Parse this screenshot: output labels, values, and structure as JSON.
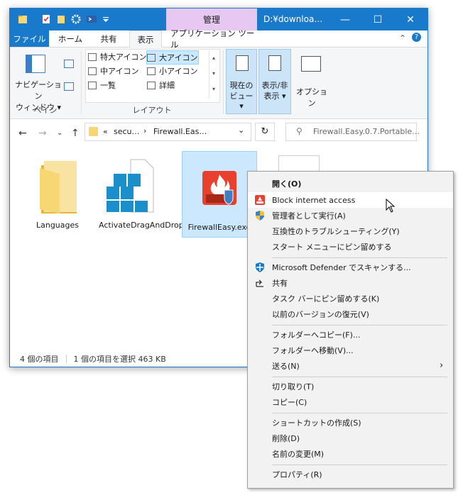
{
  "titlebar": {
    "manage_tab": "管理",
    "title": "D:¥downloa…",
    "minimize": "—",
    "maximize": "☐",
    "close": "✕"
  },
  "ribbon_tabs": {
    "file": "ファイル",
    "home": "ホーム",
    "share": "共有",
    "view": "表示",
    "app_tools": "アプリケーション ツール"
  },
  "ribbon": {
    "nav_pane_line1": "ナビゲーション",
    "nav_pane_line2": "ウィンドウ ▾",
    "pane_group": "ペイン",
    "layout_items": [
      "特大アイコン",
      "大アイコン",
      "中アイコン",
      "小アイコン",
      "一覧",
      "詳細"
    ],
    "layout_group": "レイアウト",
    "current_view_line1": "現在の",
    "current_view_line2": "ビュー ▾",
    "show_hide_line1": "表示/非",
    "show_hide_line2": "表示 ▾",
    "options": "オプション"
  },
  "address": {
    "chevrons": "«",
    "path1": "secu…",
    "sep": "›",
    "path2": "Firewall.Eas…",
    "dropdown": "⌄",
    "refresh": "↻",
    "search_placeholder": "Firewall.Easy.0.7.Portable…"
  },
  "files": [
    {
      "name": "Languages"
    },
    {
      "name": "ActivateDragAndDrop.reg"
    },
    {
      "name": "FirewallEasy.exe"
    }
  ],
  "status": {
    "count": "4 個の項目",
    "selected": "1 個の項目を選択  463 KB"
  },
  "context_menu": {
    "open": "開く(O)",
    "block": "Block internet access",
    "run_as_admin": "管理者として実行(A)",
    "compat": "互換性のトラブルシューティング(Y)",
    "pin_start": "スタート メニューにピン留めする",
    "defender": "Microsoft Defender でスキャンする...",
    "share": "共有",
    "pin_taskbar": "タスク バーにピン留めする(K)",
    "restore": "以前のバージョンの復元(V)",
    "copy_to": "フォルダーへコピー(F)...",
    "move_to": "フォルダーへ移動(V)...",
    "send_to": "送る(N)",
    "cut": "切り取り(T)",
    "copy": "コピー(C)",
    "shortcut": "ショートカットの作成(S)",
    "delete": "削除(D)",
    "rename": "名前の変更(M)",
    "properties": "プロパティ(R)"
  },
  "colors": {
    "titlebar": "#1979ca",
    "manage_tab": "#e6c8f2",
    "selection": "#cce8ff"
  }
}
